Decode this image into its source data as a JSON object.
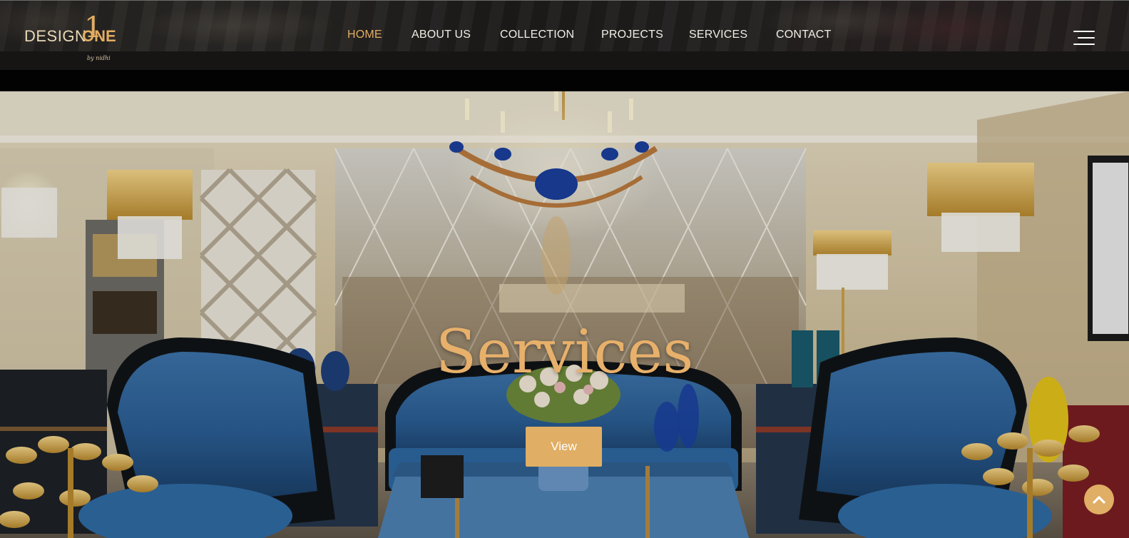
{
  "brand": {
    "logo_text_left": "DESIGN",
    "logo_text_right": "ONE",
    "logo_numeral": "1",
    "logo_tagline": "by nidhi",
    "accent_color": "#e2ad62"
  },
  "nav": {
    "items": [
      {
        "label": "HOME",
        "active": true
      },
      {
        "label": "ABOUT US",
        "active": false
      },
      {
        "label": "COLLECTION",
        "active": false
      },
      {
        "label": "PROJECTS",
        "active": false
      },
      {
        "label": "SERVICES",
        "active": false
      },
      {
        "label": "CONTACT",
        "active": false
      }
    ],
    "menu_icon": "hamburger-icon"
  },
  "hero": {
    "title": "Services",
    "button_label": "View",
    "title_color": "#e7b06b",
    "button_color": "#e0ae64"
  },
  "scroll_top": {
    "icon": "chevron-up-icon",
    "color": "#e0ae64"
  }
}
